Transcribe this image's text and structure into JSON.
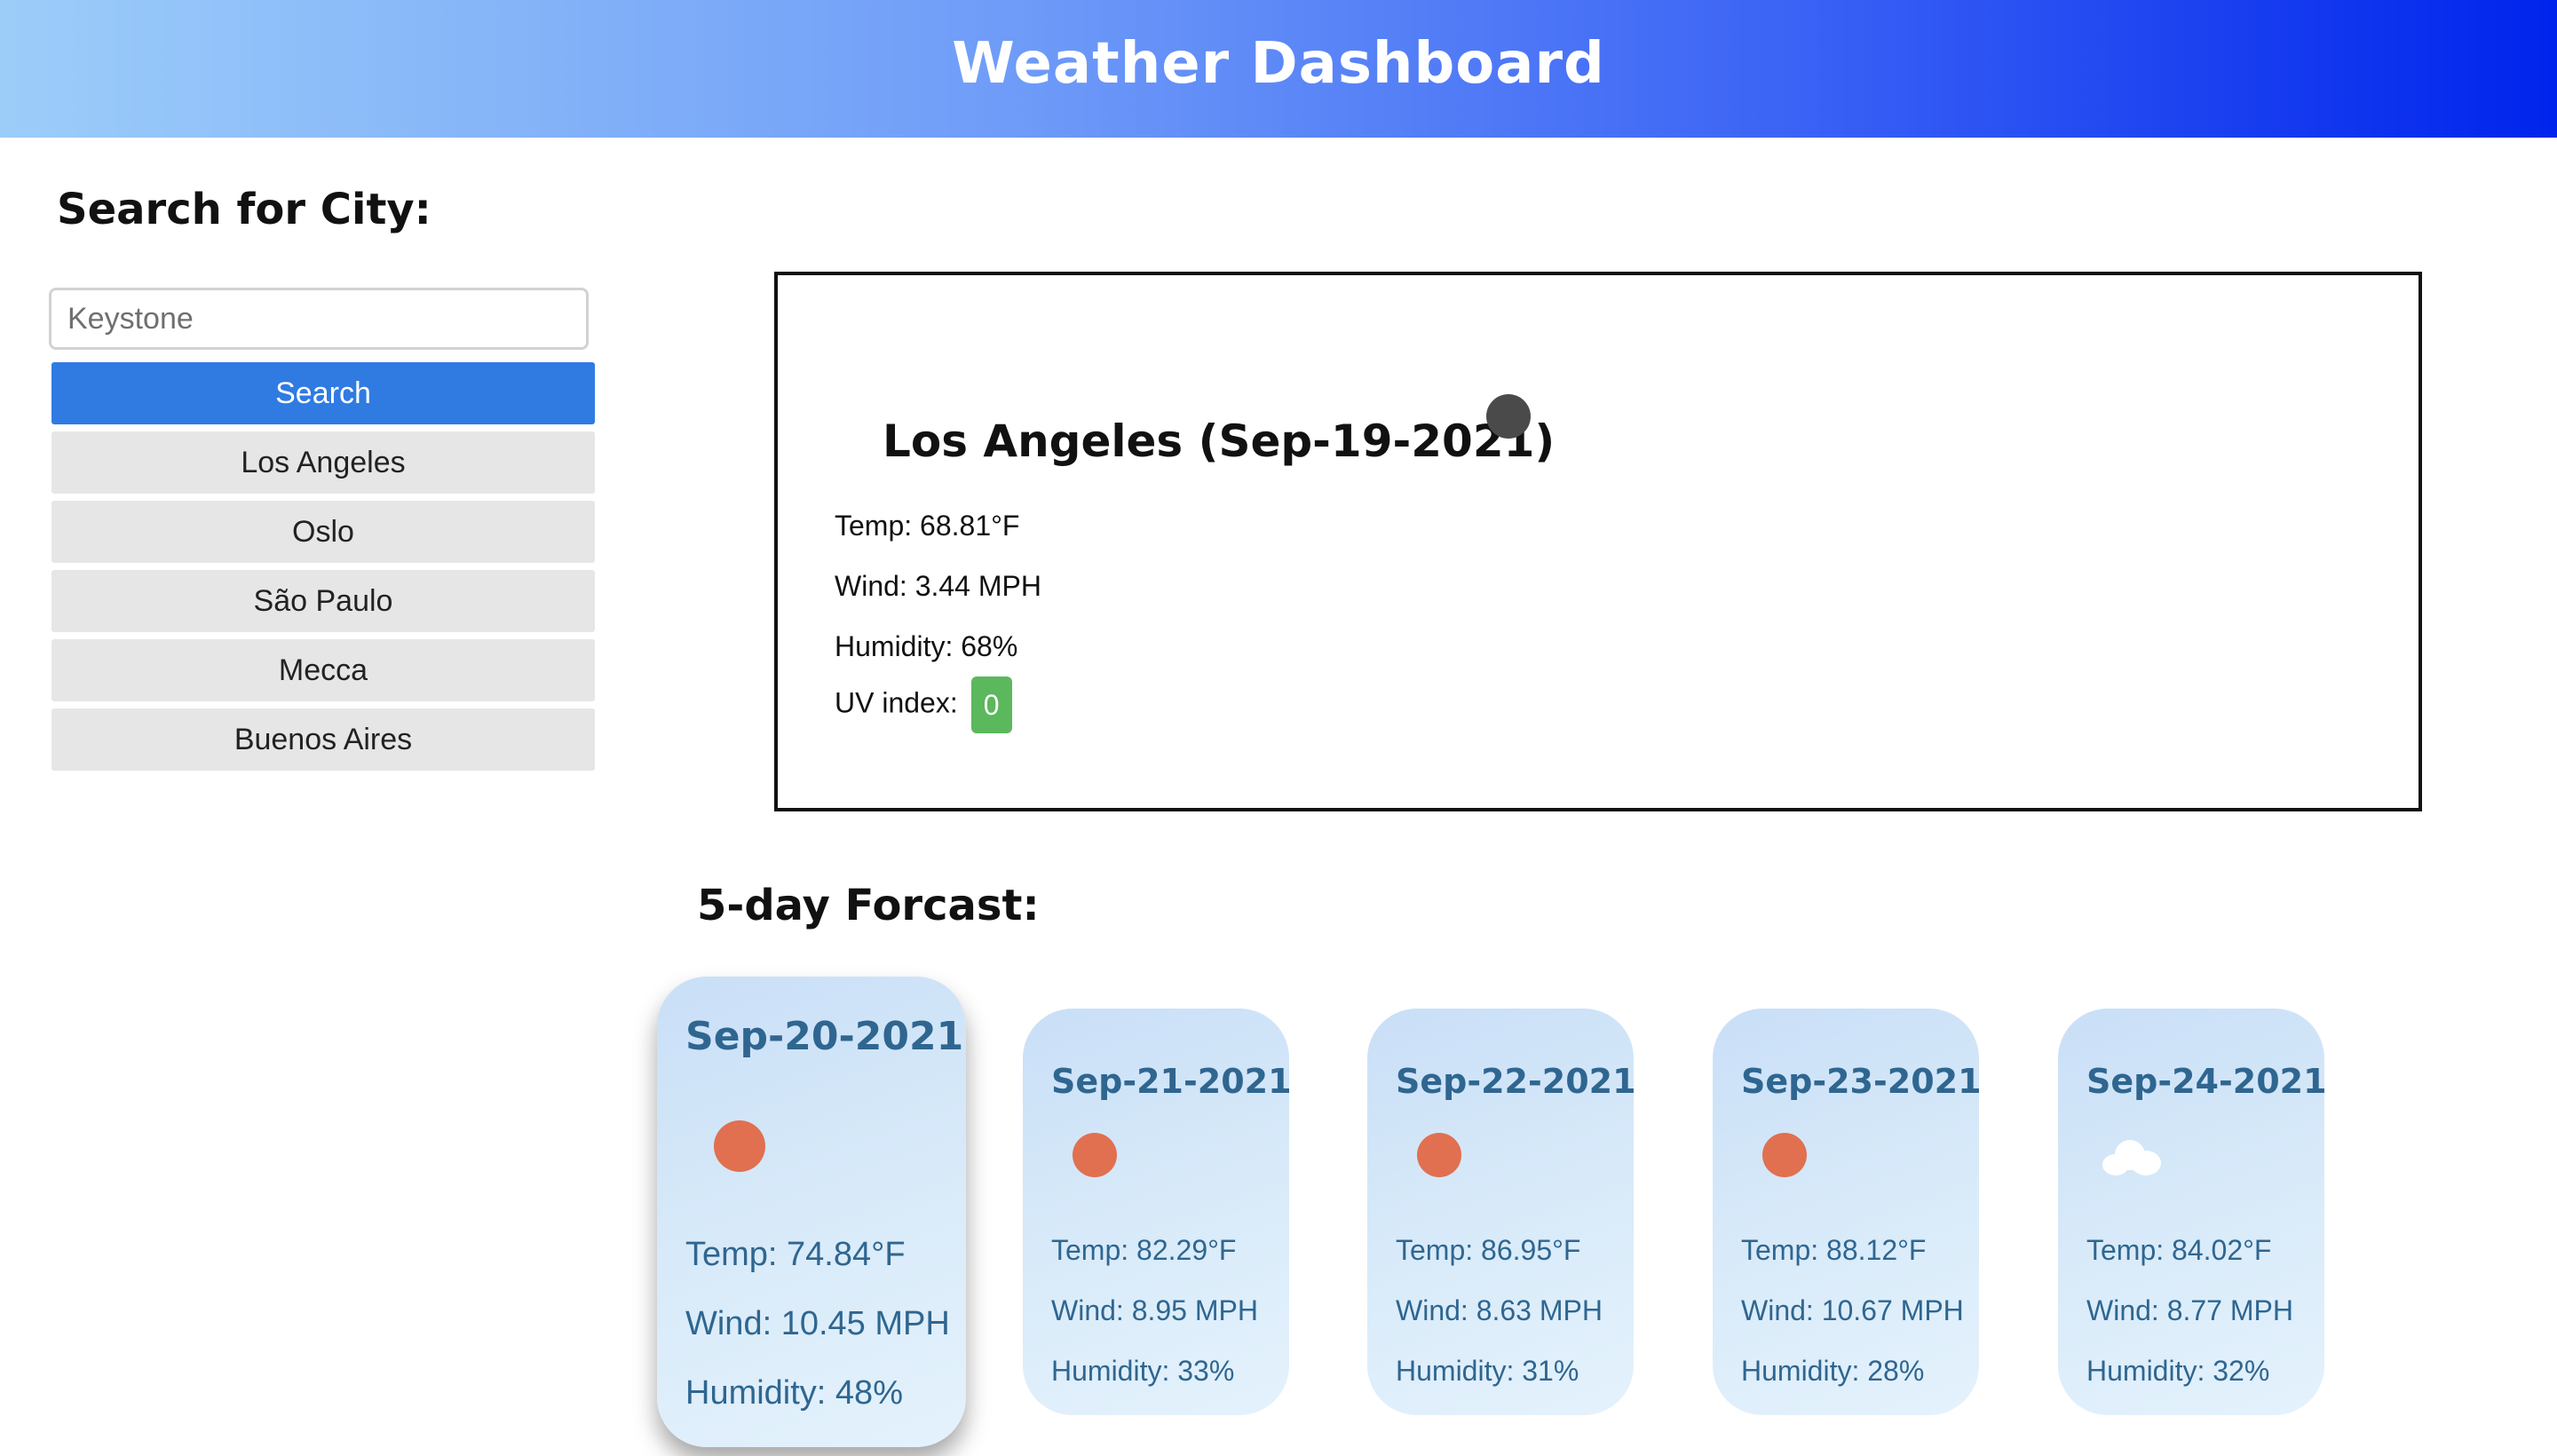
{
  "header": {
    "title": "Weather Dashboard",
    "gradient_colors": [
      "#9ccdf9",
      "#6e9bf8",
      "#3b63f5",
      "#0024ec"
    ]
  },
  "sidebar": {
    "heading": "Search for City:",
    "search_input": {
      "value": "",
      "placeholder": "Keystone"
    },
    "search_button_label": "Search",
    "search_button_color": "#2f7be2",
    "history": [
      {
        "label": "Los Angeles"
      },
      {
        "label": "Oslo"
      },
      {
        "label": "São Paulo"
      },
      {
        "label": "Mecca"
      },
      {
        "label": "Buenos Aires"
      }
    ]
  },
  "current": {
    "title": "Los Angeles (Sep-19-2021)",
    "icon": "night-dark-circle-icon",
    "temp": "Temp: 68.81°F",
    "wind": "Wind: 3.44 MPH",
    "humidity": "Humidity: 68%",
    "uv_label": "UV index:",
    "uv_value": "0",
    "uv_color": "#5cb85c"
  },
  "forecast": {
    "heading": "5-day Forcast:",
    "days": [
      {
        "date": "Sep-20-2021",
        "icon": "sun-icon",
        "temp": "Temp: 74.84°F",
        "wind": "Wind: 10.45 MPH",
        "humidity": "Humidity: 48%"
      },
      {
        "date": "Sep-21-2021",
        "icon": "sun-icon",
        "temp": "Temp: 82.29°F",
        "wind": "Wind: 8.95 MPH",
        "humidity": "Humidity: 33%"
      },
      {
        "date": "Sep-22-2021",
        "icon": "sun-icon",
        "temp": "Temp: 86.95°F",
        "wind": "Wind: 8.63 MPH",
        "humidity": "Humidity: 31%"
      },
      {
        "date": "Sep-23-2021",
        "icon": "sun-icon",
        "temp": "Temp: 88.12°F",
        "wind": "Wind: 10.67 MPH",
        "humidity": "Humidity: 28%"
      },
      {
        "date": "Sep-24-2021",
        "icon": "cloud-icon",
        "temp": "Temp: 84.02°F",
        "wind": "Wind: 8.77 MPH",
        "humidity": "Humidity: 32%"
      }
    ],
    "sun_color": "#e07050",
    "text_color": "#2f6690"
  }
}
